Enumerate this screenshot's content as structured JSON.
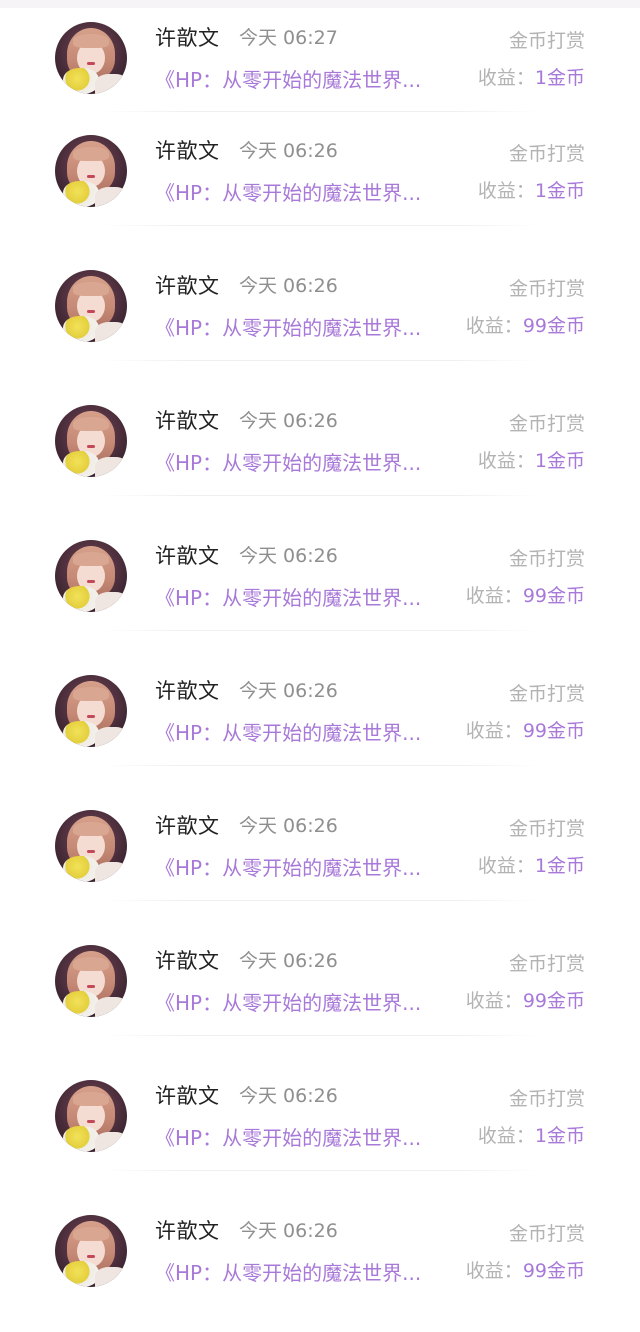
{
  "records": [
    {
      "user": "许歆文",
      "time": "今天 06:27",
      "type": "金币打赏",
      "book": "《HP：从零开始的魔法世界...",
      "earn_label": "收益：",
      "amount": "1金币"
    },
    {
      "user": "许歆文",
      "time": "今天 06:26",
      "type": "金币打赏",
      "book": "《HP：从零开始的魔法世界...",
      "earn_label": "收益：",
      "amount": "1金币"
    },
    {
      "user": "许歆文",
      "time": "今天 06:26",
      "type": "金币打赏",
      "book": "《HP：从零开始的魔法世界...",
      "earn_label": "收益：",
      "amount": "99金币"
    },
    {
      "user": "许歆文",
      "time": "今天 06:26",
      "type": "金币打赏",
      "book": "《HP：从零开始的魔法世界...",
      "earn_label": "收益：",
      "amount": "1金币"
    },
    {
      "user": "许歆文",
      "time": "今天 06:26",
      "type": "金币打赏",
      "book": "《HP：从零开始的魔法世界...",
      "earn_label": "收益：",
      "amount": "99金币"
    },
    {
      "user": "许歆文",
      "time": "今天 06:26",
      "type": "金币打赏",
      "book": "《HP：从零开始的魔法世界...",
      "earn_label": "收益：",
      "amount": "99金币"
    },
    {
      "user": "许歆文",
      "time": "今天 06:26",
      "type": "金币打赏",
      "book": "《HP：从零开始的魔法世界...",
      "earn_label": "收益：",
      "amount": "1金币"
    },
    {
      "user": "许歆文",
      "time": "今天 06:26",
      "type": "金币打赏",
      "book": "《HP：从零开始的魔法世界...",
      "earn_label": "收益：",
      "amount": "99金币"
    },
    {
      "user": "许歆文",
      "time": "今天 06:26",
      "type": "金币打赏",
      "book": "《HP：从零开始的魔法世界...",
      "earn_label": "收益：",
      "amount": "1金币"
    },
    {
      "user": "许歆文",
      "time": "今天 06:26",
      "type": "金币打赏",
      "book": "《HP：从零开始的魔法世界...",
      "earn_label": "收益：",
      "amount": "99金币"
    }
  ],
  "colors": {
    "accent": "#a879d8",
    "name": "#222222",
    "secondary": "#8f8f8f",
    "muted": "#b3b3b3"
  },
  "icons": {
    "avatar": "user-avatar-photo"
  }
}
